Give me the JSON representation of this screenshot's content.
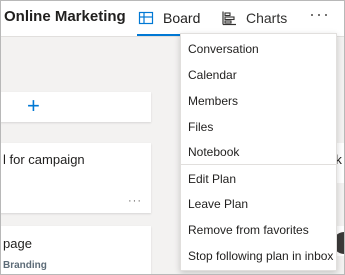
{
  "header": {
    "plan_title": "Online Marketing",
    "tabs": [
      {
        "label": "Board",
        "icon": "board-icon",
        "active": true
      },
      {
        "label": "Charts",
        "icon": "charts-icon",
        "active": false
      }
    ],
    "more_label": "···"
  },
  "board": {
    "add_task_symbol": "+",
    "cards": [
      {
        "title_fragment": "l for campaign",
        "more_label": "···"
      },
      {
        "title_fragment": "page",
        "label": "Branding"
      }
    ],
    "right_card_fragment": "rk"
  },
  "menu": {
    "group1": [
      "Conversation",
      "Calendar",
      "Members",
      "Files",
      "Notebook"
    ],
    "group2": [
      "Edit Plan",
      "Leave Plan",
      "Remove from favorites",
      "Stop following plan in inbox"
    ]
  },
  "colors": {
    "accent": "#0078d4",
    "background": "#f3f2f1",
    "label": "#5c6b77"
  }
}
